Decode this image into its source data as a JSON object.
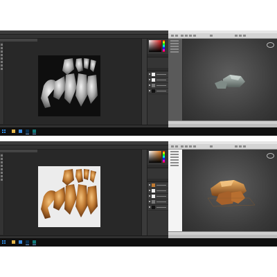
{
  "panels": [
    {
      "id": "top",
      "photoshop": {
        "document_tab": "",
        "canvas_mode": "grayscale-height-map",
        "canvas_background": "#0e0e0e",
        "layer_rows": 4
      },
      "max": {
        "title_bar": "light",
        "scene_explorer": "dark",
        "object_color": "#8c9a94"
      }
    },
    {
      "id": "bottom",
      "photoshop": {
        "document_tab": "",
        "canvas_mode": "diffuse-orange",
        "canvas_background": "#ececec",
        "layer_rows": 5
      },
      "max": {
        "title_bar": "light",
        "scene_explorer": "light",
        "object_color": "#c07a32"
      }
    }
  ],
  "colors": {
    "ps_background": "#282828",
    "ps_panel": "#353535",
    "max_viewport": "#444444",
    "taskbar": "#0f0f0f",
    "accent": "#2e8ee6"
  },
  "icons": {
    "start": "windows-start-icon",
    "photoshop": "photoshop-icon",
    "max": "3ds-max-icon",
    "explorer": "folder-icon",
    "browser": "browser-icon"
  }
}
